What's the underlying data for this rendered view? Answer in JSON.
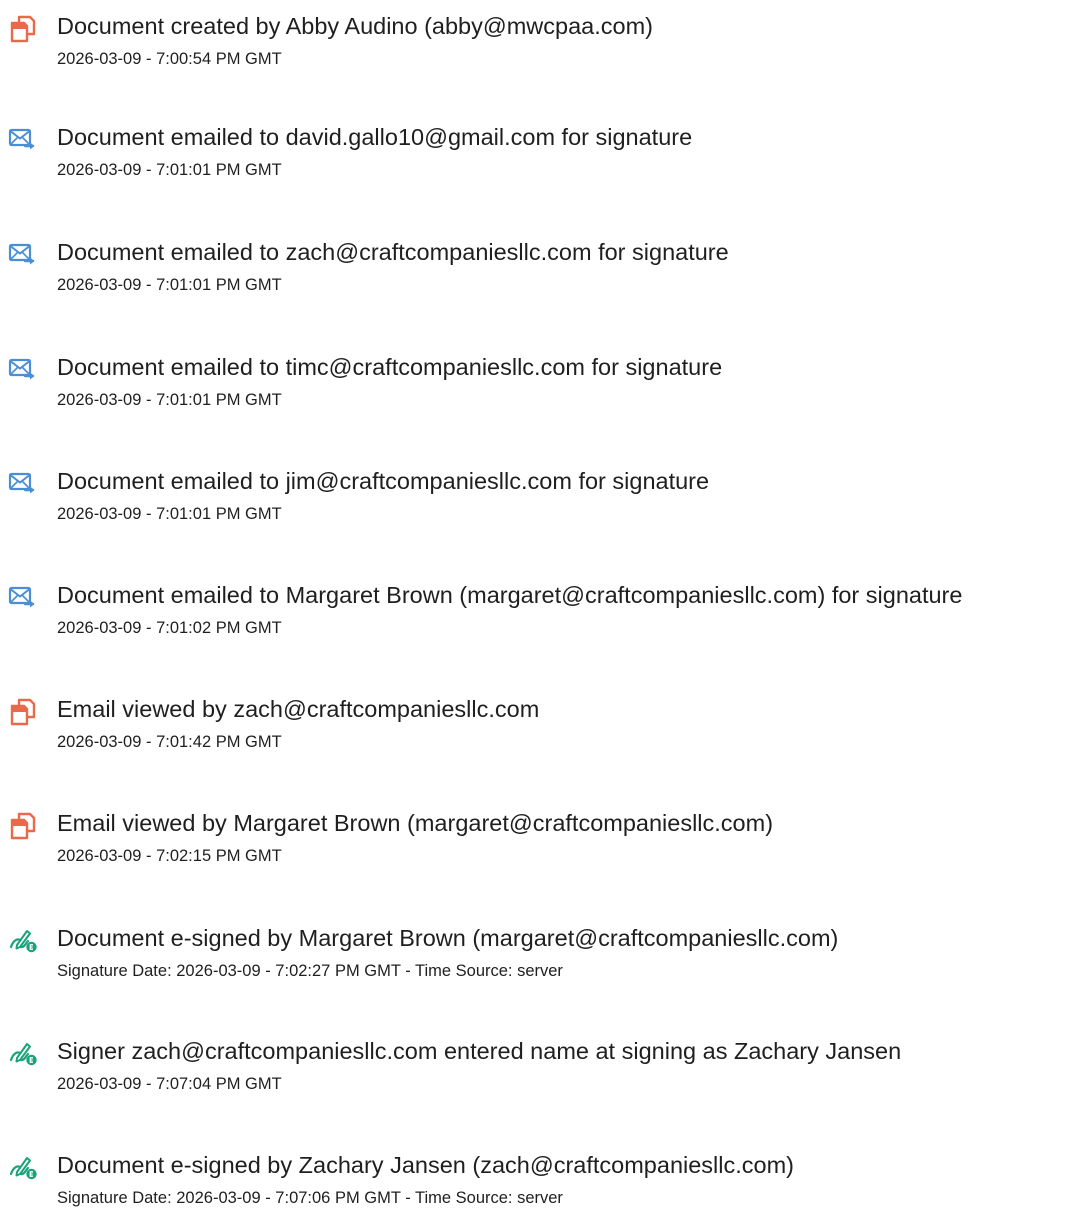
{
  "entries": [
    {
      "icon": "document-created-icon",
      "text": "Document created by Abby Audino (abby@mwcpaa.com)",
      "time": "2026-03-09 - 7:00:54 PM GMT"
    },
    {
      "icon": "email-sent-icon",
      "text": "Document emailed to david.gallo10@gmail.com for signature",
      "time": "2026-03-09 - 7:01:01 PM GMT"
    },
    {
      "icon": "email-sent-icon",
      "text": "Document emailed to zach@craftcompaniesllc.com for signature",
      "time": "2026-03-09 - 7:01:01 PM GMT"
    },
    {
      "icon": "email-sent-icon",
      "text": "Document emailed to timc@craftcompaniesllc.com for signature",
      "time": "2026-03-09 - 7:01:01 PM GMT"
    },
    {
      "icon": "email-sent-icon",
      "text": "Document emailed to jim@craftcompaniesllc.com for signature",
      "time": "2026-03-09 - 7:01:01 PM GMT"
    },
    {
      "icon": "email-sent-icon",
      "text": "Document emailed to Margaret Brown (margaret@craftcompaniesllc.com) for signature",
      "time": "2026-03-09 - 7:01:02 PM GMT"
    },
    {
      "icon": "document-viewed-icon",
      "text": "Email viewed by zach@craftcompaniesllc.com",
      "time": "2026-03-09 - 7:01:42 PM GMT"
    },
    {
      "icon": "document-viewed-icon",
      "text": "Email viewed by Margaret Brown (margaret@craftcompaniesllc.com)",
      "time": "2026-03-09 - 7:02:15 PM GMT"
    },
    {
      "icon": "e-sign-icon",
      "text": "Document e-signed by Margaret Brown (margaret@craftcompaniesllc.com)",
      "time": "Signature Date: 2026-03-09 - 7:02:27 PM GMT - Time Source: server"
    },
    {
      "icon": "e-sign-icon",
      "text": "Signer zach@craftcompaniesllc.com entered name at signing as Zachary Jansen",
      "time": "2026-03-09 - 7:07:04 PM GMT"
    },
    {
      "icon": "e-sign-icon",
      "text": "Document e-signed by Zachary Jansen (zach@craftcompaniesllc.com)",
      "time": "Signature Date: 2026-03-09 - 7:07:06 PM GMT - Time Source: server"
    }
  ],
  "colors": {
    "document_icon": "#e86a4a",
    "email_icon": "#4a8fd6",
    "sign_icon": "#1aa37a",
    "text": "#1f1f1f"
  }
}
